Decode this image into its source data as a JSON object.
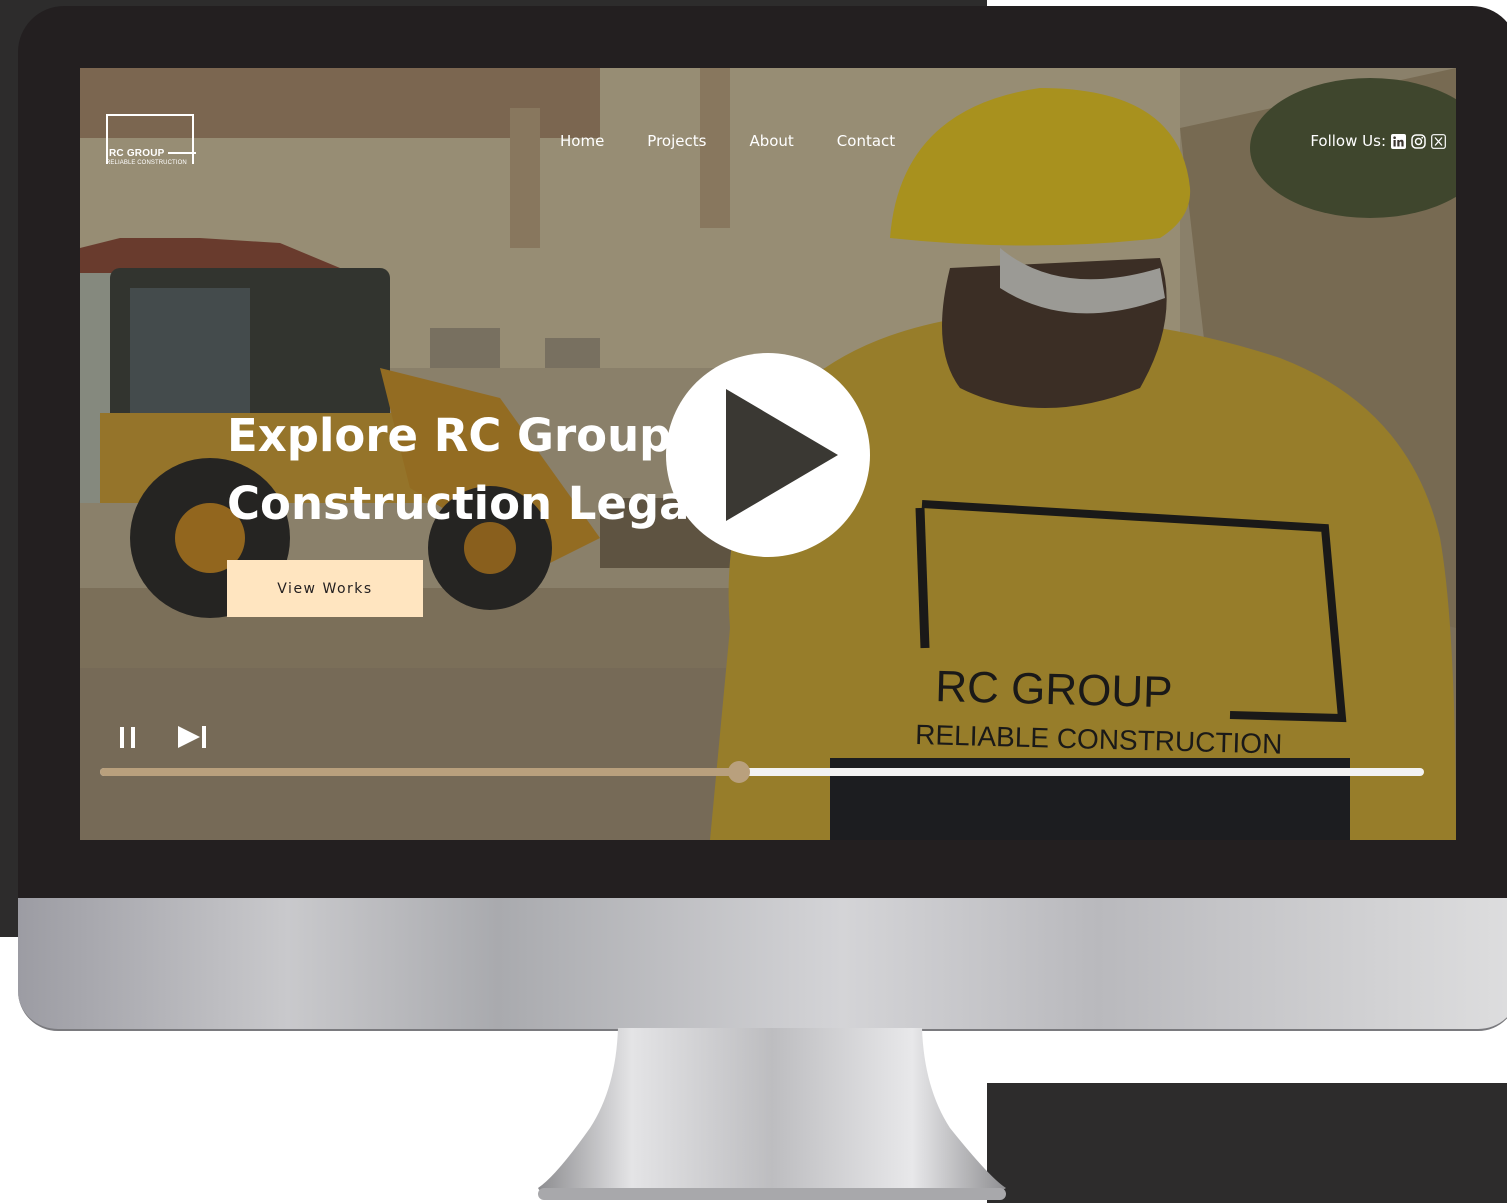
{
  "site": {
    "logo": {
      "name": "RC GROUP",
      "tagline": "RELIABLE CONSTRUCTION"
    },
    "nav": [
      {
        "label": "Home"
      },
      {
        "label": "Projects"
      },
      {
        "label": "About"
      },
      {
        "label": "Contact"
      }
    ],
    "follow": {
      "label": "Follow Us:",
      "icons": [
        "linkedin-icon",
        "instagram-icon",
        "x-icon"
      ]
    }
  },
  "hero": {
    "title_line1": "Explore RC Group",
    "title_line2": "Construction Legacy",
    "cta_label": "View Works"
  },
  "scene_text": {
    "shirt_line1": "RC GROUP",
    "shirt_line2": "RELIABLE CONSTRUCTION"
  },
  "video": {
    "progress": 0.483,
    "controls": [
      "pause-icon",
      "skip-next-icon"
    ]
  },
  "colors": {
    "cta_bg": "#ffe5c0",
    "progress_played": "#b9a07d",
    "progress_track": "#f2f2f2",
    "frame": "#231f20"
  }
}
